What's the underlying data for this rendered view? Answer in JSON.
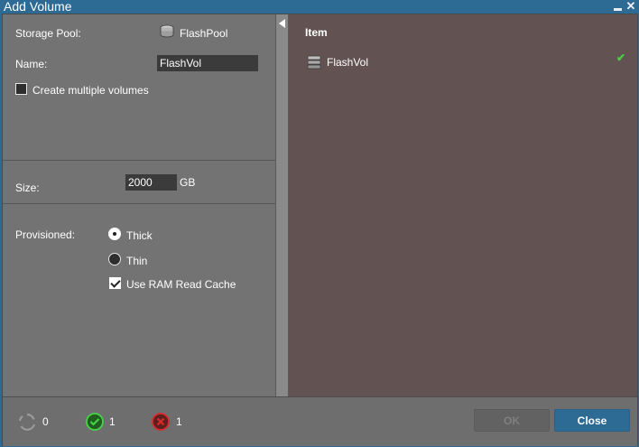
{
  "window": {
    "title": "Add Volume",
    "controls": {
      "minimize_icon": "minimize-icon",
      "close_icon": "close-icon",
      "close_glyph": "✕"
    }
  },
  "form": {
    "storage_pool_label": "Storage Pool:",
    "storage_pool_value": "FlashPool",
    "name_label": "Name:",
    "name_value": "FlashVol",
    "create_multiple_label": "Create multiple volumes",
    "create_multiple_checked": false,
    "size_label": "Size:",
    "size_value": "2000",
    "size_unit": "GB",
    "provisioned_label": "Provisioned:",
    "provision_options": [
      {
        "label": "Thick",
        "selected": true
      },
      {
        "label": "Thin",
        "selected": false
      }
    ],
    "ram_cache_label": "Use RAM Read Cache",
    "ram_cache_checked": true
  },
  "items_panel": {
    "column_header": "Item",
    "items": [
      {
        "label": "FlashVol",
        "icon": "volume-icon",
        "status_icon": "check-icon",
        "status_glyph": "✔"
      }
    ]
  },
  "footer": {
    "pending_count": "0",
    "success_count": "1",
    "error_count": "1",
    "ok_label": "OK",
    "close_label": "Close"
  },
  "colors": {
    "titlebar": "#2d6a94",
    "left_pane": "#737373",
    "right_pane": "#625252",
    "success": "#46d246",
    "error": "#d62b2b",
    "primary_button": "#2d6a94"
  }
}
